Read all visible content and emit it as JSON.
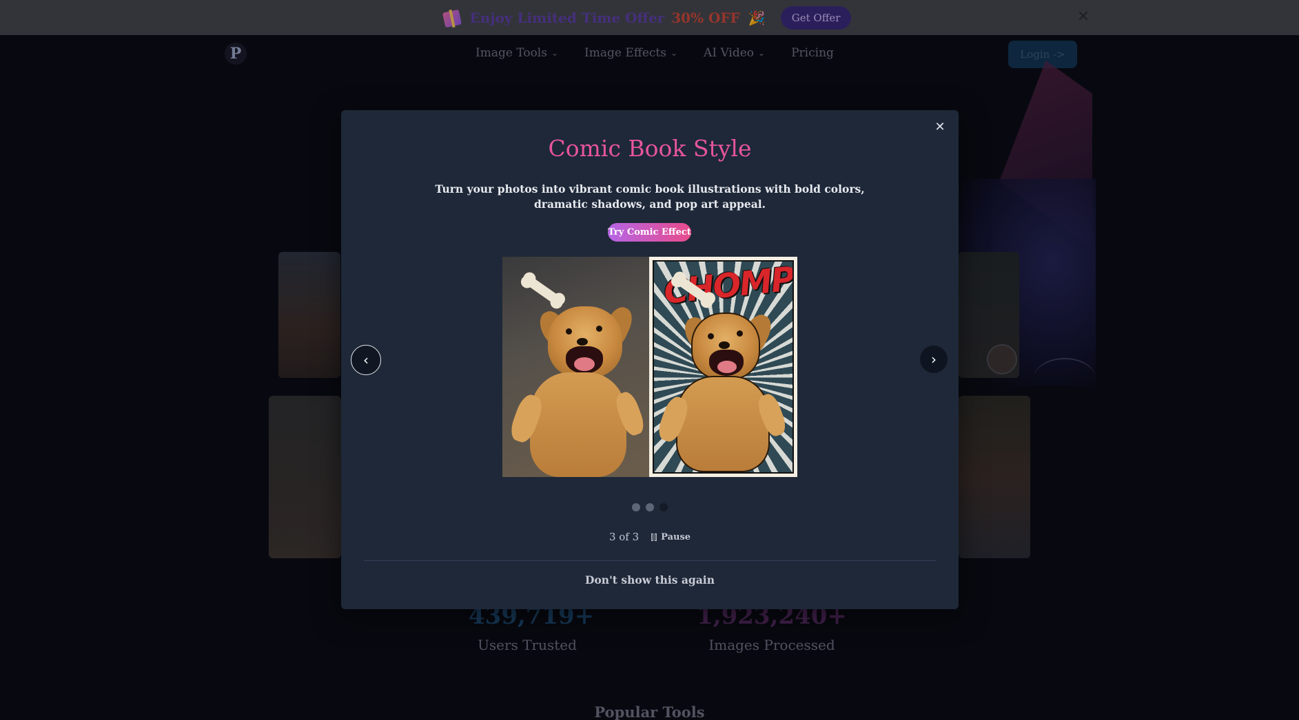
{
  "promo": {
    "text": "Enjoy Limited Time Offer",
    "discount": "30% OFF",
    "button_label": "Get Offer",
    "close_label": "✕"
  },
  "nav": {
    "logo_letter": "P",
    "menu": [
      {
        "label": "Image Tools",
        "has_dropdown": true
      },
      {
        "label": "Image Effects",
        "has_dropdown": true
      },
      {
        "label": "AI Video",
        "has_dropdown": true
      },
      {
        "label": "Pricing",
        "has_dropdown": false
      }
    ],
    "login_label": "Login ->"
  },
  "stats": [
    {
      "value": "439,719+",
      "label": "Users Trusted"
    },
    {
      "value": "1,923,240+",
      "label": "Images Processed"
    }
  ],
  "popular_heading": "Popular Tools",
  "modal": {
    "close_label": "✕",
    "title": "Comic Book Style",
    "description": "Turn your photos into vibrant comic book illustrations with bold colors, dramatic shadows, and pop art appeal.",
    "cta_label": "Try Comic Effect",
    "comic_caption": "CHOMP!",
    "prev_label": "‹",
    "next_label": "›",
    "slides_total": 3,
    "current_slide": 3,
    "counter_text": "3 of 3",
    "pause_label": "Pause",
    "dont_show_label": "Don't show this again"
  },
  "colors": {
    "title_pink": "#e7559d",
    "cta_gradient_start": "#b565e6",
    "cta_gradient_end": "#e84c8c",
    "modal_bg": "#1e2838"
  }
}
